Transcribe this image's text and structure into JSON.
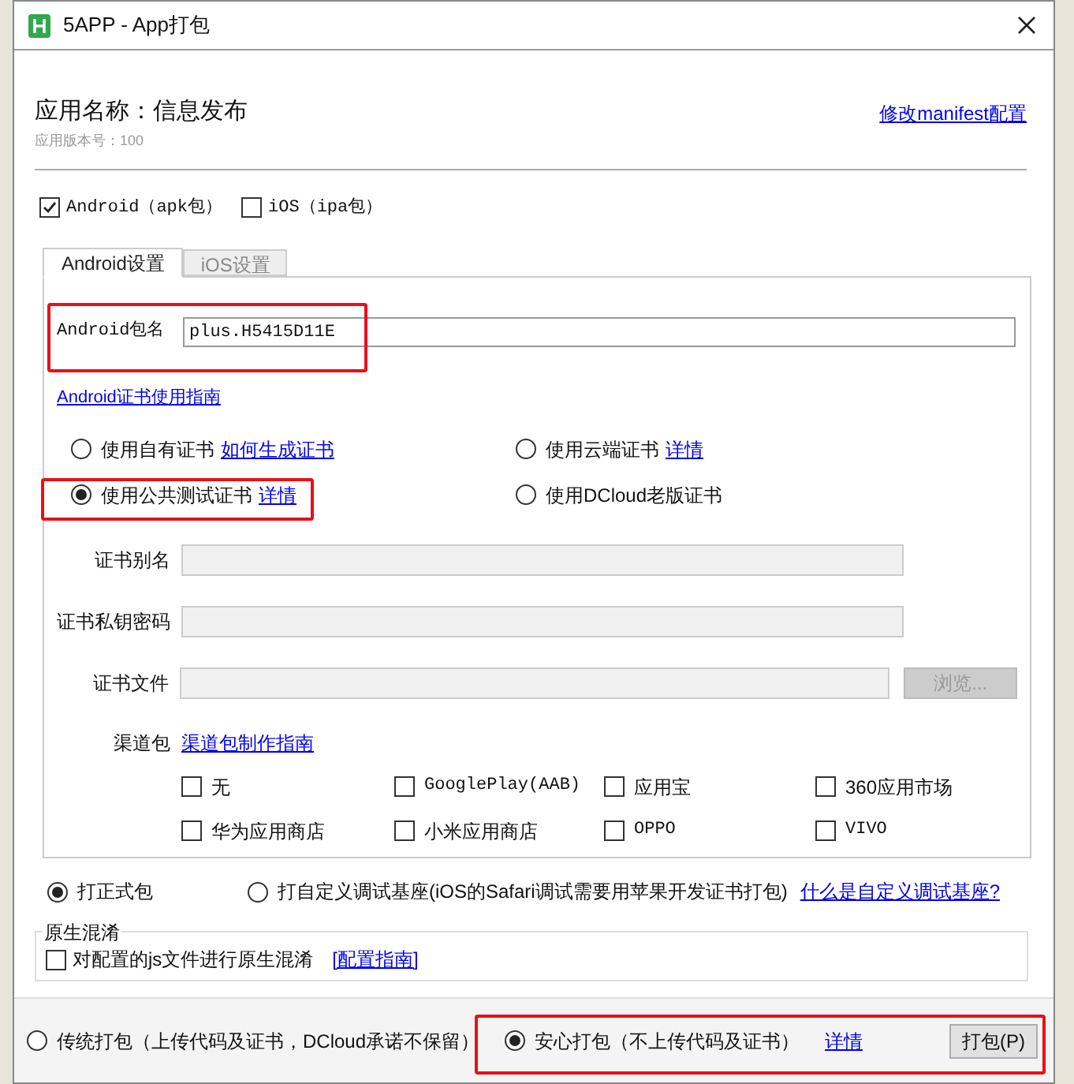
{
  "window": {
    "title": "5APP - App打包"
  },
  "app": {
    "name": "应用名称：信息发布",
    "version": "应用版本号：100",
    "manifest_link": "修改manifest配置"
  },
  "platforms": [
    {
      "label": "Android（apk包）",
      "checked": true
    },
    {
      "label": "iOS（ipa包）",
      "checked": false
    }
  ],
  "tabs": [
    {
      "label": "Android设置",
      "selected": true
    },
    {
      "label": "iOS设置",
      "selected": false
    }
  ],
  "package": {
    "label": "Android包名",
    "value": "plus.H5415D11E"
  },
  "cert_guide_link": "Android证书使用指南",
  "cert_options": [
    {
      "label": "使用自有证书",
      "link": "如何生成证书",
      "selected": false
    },
    {
      "label": "使用云端证书",
      "link": "详情",
      "selected": false
    },
    {
      "label": "使用公共测试证书",
      "link": "详情",
      "selected": true
    },
    {
      "label": "使用DCloud老版证书",
      "selected": false
    }
  ],
  "cert_fields": [
    {
      "label": "证书别名"
    },
    {
      "label": "证书私钥密码"
    },
    {
      "label": "证书文件",
      "button": "浏览..."
    }
  ],
  "channels": {
    "label": "渠道包",
    "link": "渠道包制作指南",
    "items": [
      {
        "label": "无",
        "checked": false
      },
      {
        "label": "GooglePlay(AAB)",
        "checked": false
      },
      {
        "label": "应用宝",
        "checked": false
      },
      {
        "label": "360应用市场",
        "checked": false
      },
      {
        "label": "华为应用商店",
        "checked": false
      },
      {
        "label": "小米应用商店",
        "checked": false
      },
      {
        "label": "OPPO",
        "checked": false
      },
      {
        "label": "VIVO",
        "checked": false
      }
    ]
  },
  "build_types": [
    {
      "label": "打正式包",
      "selected": true
    },
    {
      "label": "打自定义调试基座(iOS的Safari调试需要用苹果开发证书打包)",
      "selected": false
    }
  ],
  "build_types_link": "什么是自定义调试基座?",
  "obfuscation": {
    "title": "原生混淆",
    "option": {
      "label": "对配置的js文件进行原生混淆",
      "checked": false
    },
    "link": "[配置指南]"
  },
  "pack_modes": [
    {
      "label": "传统打包（上传代码及证书，DCloud承诺不保留）",
      "selected": false
    },
    {
      "label": "安心打包（不上传代码及证书）",
      "selected": true
    }
  ],
  "pack_modes_link": "详情",
  "pack_button": "打包(P)"
}
